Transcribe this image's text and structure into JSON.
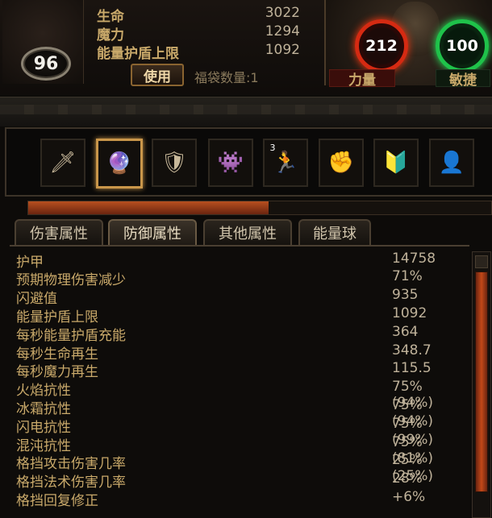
{
  "character": {
    "level": "96",
    "stats": [
      {
        "label": "生命",
        "value": "3022"
      },
      {
        "label": "魔力",
        "value": "1294"
      },
      {
        "label": "能量护盾上限",
        "value": "1092"
      }
    ],
    "use_button": "使用",
    "bag_count": "福袋数量:1"
  },
  "attributes": {
    "strength_value": "212",
    "strength_label": "力量",
    "dexterity_value": "100",
    "dexterity_label": "敏捷"
  },
  "skills": [
    {
      "icon": "sword-icon",
      "glyph": "🗡"
    },
    {
      "icon": "arcane-globe-icon",
      "glyph": "🔮",
      "selected": true
    },
    {
      "icon": "shield-strike-icon",
      "glyph": "🛡"
    },
    {
      "icon": "shadow-figure-icon",
      "glyph": "👾"
    },
    {
      "icon": "running-figure-icon",
      "glyph": "🏃",
      "badge": "3"
    },
    {
      "icon": "fire-fist-icon",
      "glyph": "✊"
    },
    {
      "icon": "rune-shield-icon",
      "glyph": "🔰"
    },
    {
      "icon": "ghost-figure-icon",
      "glyph": "👤"
    }
  ],
  "progress": 0.52,
  "tabs": [
    "伤害属性",
    "防御属性",
    "其他属性",
    "能量球"
  ],
  "active_tab": 1,
  "defense_stats": [
    {
      "label": "护甲",
      "value": "14758"
    },
    {
      "label": "预期物理伤害减少",
      "value": "71%"
    },
    {
      "label": "闪避值",
      "value": "935"
    },
    {
      "label": "能量护盾上限",
      "value": "1092"
    },
    {
      "label": "每秒能量护盾充能",
      "value": "364"
    },
    {
      "label": "每秒生命再生",
      "value": "348.7"
    },
    {
      "label": "每秒魔力再生",
      "value": "115.5"
    },
    {
      "label": "火焰抗性",
      "value": "75% (94%)"
    },
    {
      "label": "冰霜抗性",
      "value": "75% (94%)"
    },
    {
      "label": "闪电抗性",
      "value": "75% (99%)"
    },
    {
      "label": "混沌抗性",
      "value": "75% (81%)"
    },
    {
      "label": "格挡攻击伤害几率",
      "value": "25% (25%)"
    },
    {
      "label": "格挡法术伤害几率",
      "value": "28%"
    },
    {
      "label": "格挡回复修正",
      "value": "+6%"
    },
    {
      "label": "",
      "value": ""
    }
  ],
  "colors": {
    "strength": "#d52a12",
    "dexterity": "#1fc24a",
    "label_gold": "#c9a96a",
    "accent_frame": "#c9964a"
  }
}
